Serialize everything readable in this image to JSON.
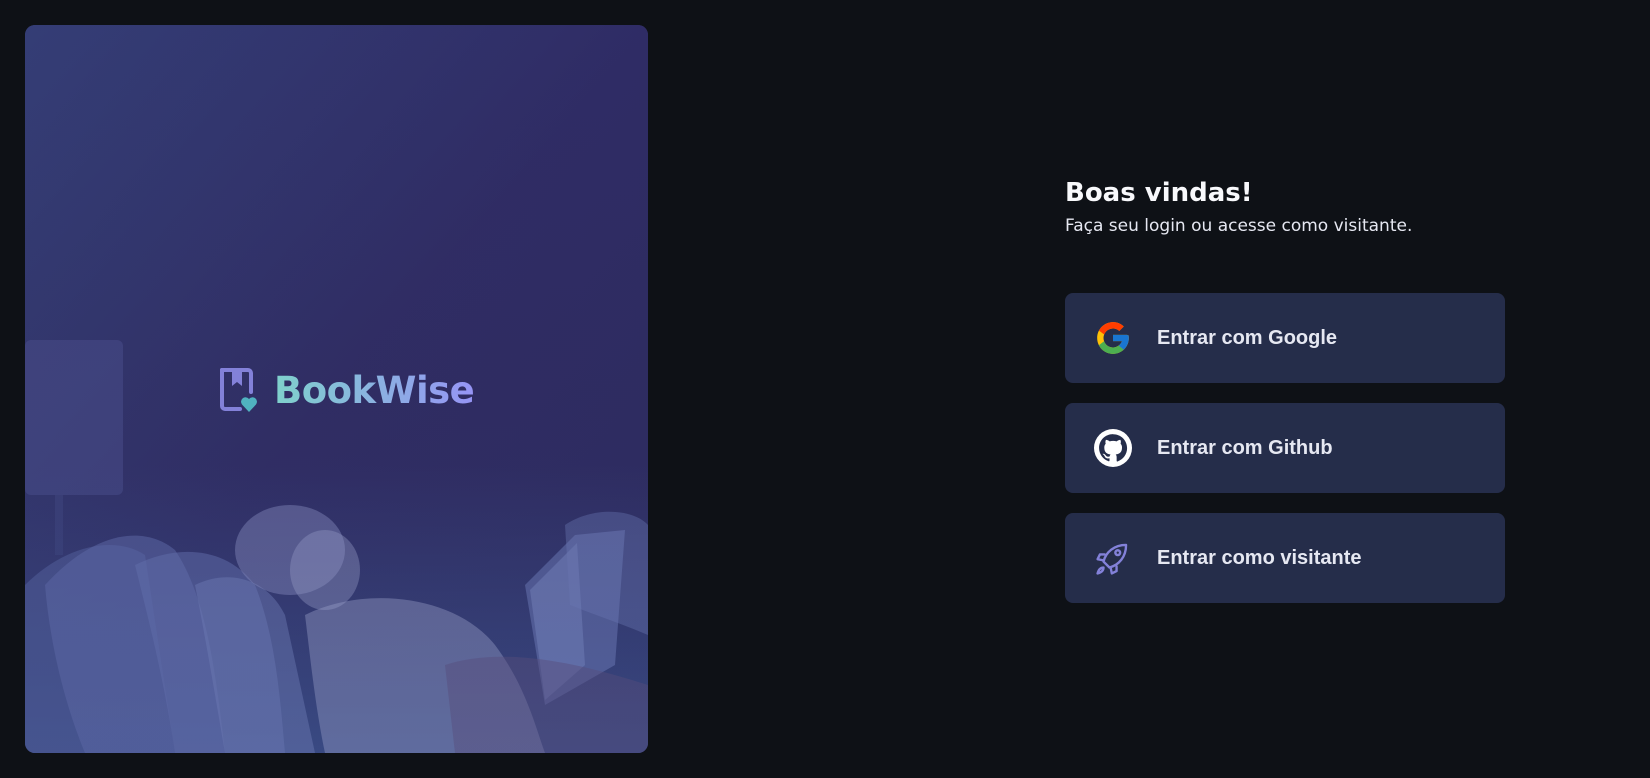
{
  "hero": {
    "brand_name": "BookWise",
    "colors": {
      "brand_gradient_start": "#7fd1cc",
      "brand_gradient_end": "#9694f5",
      "icon_primary": "#8381d9",
      "icon_heart": "#50b2c0"
    }
  },
  "login": {
    "title": "Boas vindas!",
    "subtitle": "Faça seu login ou acesse como visitante.",
    "providers": [
      {
        "label": "Entrar com Google",
        "icon": "google-icon"
      },
      {
        "label": "Entrar com Github",
        "icon": "github-icon"
      },
      {
        "label": "Entrar como visitante",
        "icon": "rocket-icon"
      }
    ]
  },
  "colors": {
    "background": "#0e1116",
    "button_background": "#252d4a",
    "text_primary": "#f8f9fc",
    "text_secondary": "#e6e8f2",
    "accent_purple": "#8381d9"
  }
}
